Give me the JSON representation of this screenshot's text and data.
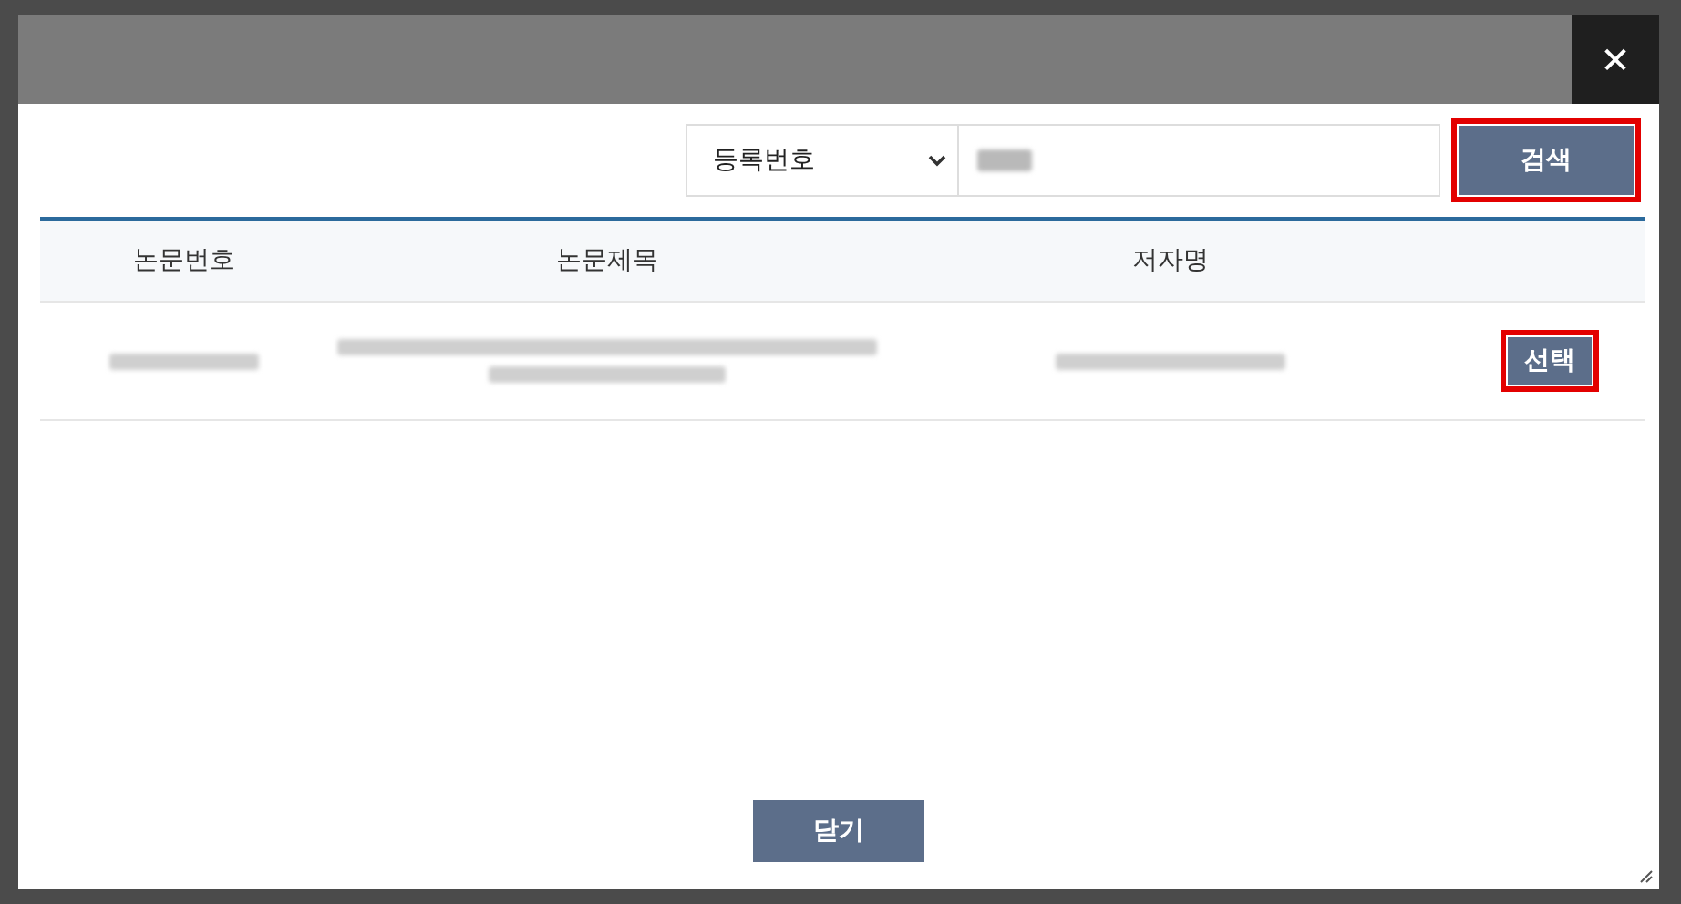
{
  "search": {
    "field_options_selected": "등록번호",
    "button": {
      "label": "검색",
      "highlighted": true
    }
  },
  "table": {
    "columns": [
      "논문번호",
      "논문제목",
      "저자명"
    ],
    "rows": [
      {
        "action": {
          "label": "선택",
          "highlighted": true
        }
      }
    ]
  },
  "footer": {
    "close_label": "닫기"
  },
  "dialog": {
    "close_glyph": "✕"
  }
}
